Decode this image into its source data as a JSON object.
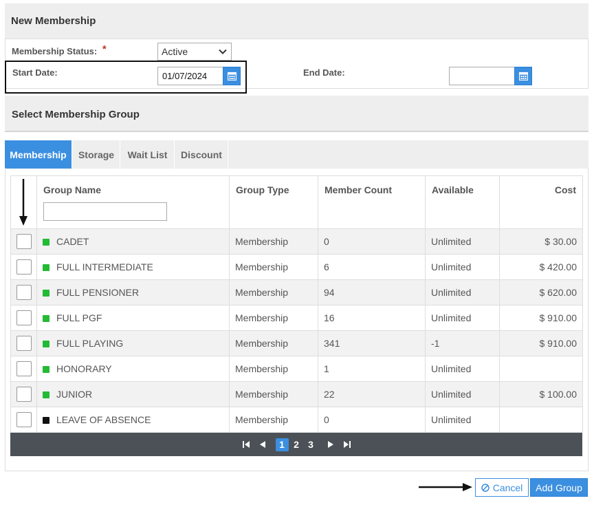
{
  "new_membership": {
    "title": "New Membership",
    "status_label": "Membership Status:",
    "required_mark": "*",
    "status_value": "Active",
    "start_date_label": "Start Date:",
    "start_date_value": "01/07/2024",
    "end_date_label": "End Date:",
    "end_date_value": ""
  },
  "group_section": {
    "title": "Select Membership Group",
    "tabs": [
      {
        "label": "Membership",
        "active": true
      },
      {
        "label": "Storage",
        "active": false
      },
      {
        "label": "Wait List",
        "active": false
      },
      {
        "label": "Discount",
        "active": false
      }
    ]
  },
  "table": {
    "columns": [
      "Group Name",
      "Group Type",
      "Member Count",
      "Available",
      "Cost"
    ],
    "filter_placeholder": "",
    "rows": [
      {
        "name": "CADET",
        "type": "Membership",
        "count": "0",
        "available": "Unlimited",
        "cost": "$ 30.00",
        "color": "#22bb33"
      },
      {
        "name": "FULL INTERMEDIATE",
        "type": "Membership",
        "count": "6",
        "available": "Unlimited",
        "cost": "$ 420.00",
        "color": "#22bb33"
      },
      {
        "name": "FULL PENSIONER",
        "type": "Membership",
        "count": "94",
        "available": "Unlimited",
        "cost": "$ 620.00",
        "color": "#22bb33"
      },
      {
        "name": "FULL PGF",
        "type": "Membership",
        "count": "16",
        "available": "Unlimited",
        "cost": "$ 910.00",
        "color": "#22bb33"
      },
      {
        "name": "FULL PLAYING",
        "type": "Membership",
        "count": "341",
        "available": "-1",
        "cost": "$ 910.00",
        "color": "#22bb33"
      },
      {
        "name": "HONORARY",
        "type": "Membership",
        "count": "1",
        "available": "Unlimited",
        "cost": "",
        "color": "#22bb33"
      },
      {
        "name": "JUNIOR",
        "type": "Membership",
        "count": "22",
        "available": "Unlimited",
        "cost": "$ 100.00",
        "color": "#22bb33"
      },
      {
        "name": "LEAVE OF ABSENCE",
        "type": "Membership",
        "count": "0",
        "available": "Unlimited",
        "cost": "",
        "color": "#111111"
      }
    ]
  },
  "pager": {
    "pages": [
      "1",
      "2",
      "3"
    ],
    "current": "1"
  },
  "actions": {
    "cancel_label": "Cancel",
    "add_label": "Add Group"
  },
  "colors": {
    "accent": "#3b8fe0",
    "pager_bg": "#4b5157",
    "required": "#c0392b"
  }
}
